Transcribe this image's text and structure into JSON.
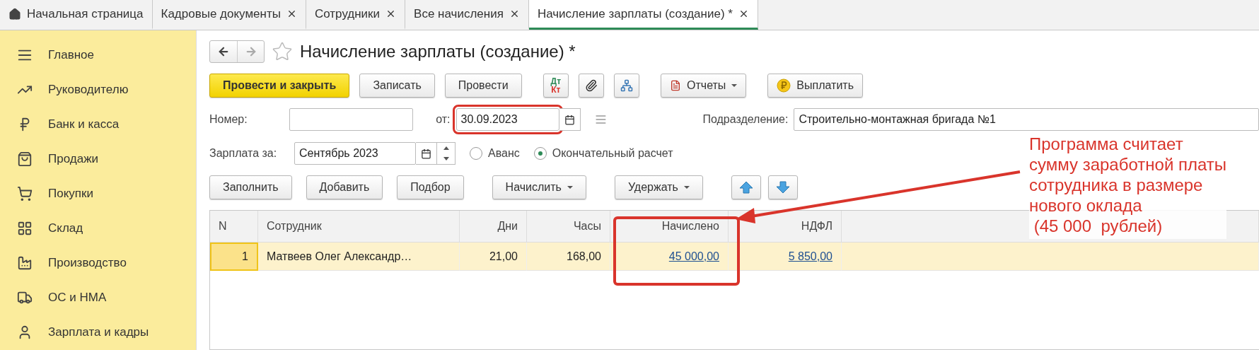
{
  "tabs": [
    {
      "kind": "home",
      "label": "Начальная страница",
      "selected": false
    },
    {
      "kind": "doc",
      "label": "Кадровые документы",
      "selected": false
    },
    {
      "kind": "doc",
      "label": "Сотрудники",
      "selected": false
    },
    {
      "kind": "doc",
      "label": "Все начисления",
      "selected": false
    },
    {
      "kind": "doc",
      "label": "Начисление зарплаты (создание) *",
      "selected": true
    }
  ],
  "sidebar": {
    "items": [
      {
        "kind": "menu",
        "label": "Главное"
      },
      {
        "kind": "trend",
        "label": "Руководителю"
      },
      {
        "kind": "ruble",
        "label": "Банк и касса"
      },
      {
        "kind": "bag",
        "label": "Продажи"
      },
      {
        "kind": "cart",
        "label": "Покупки"
      },
      {
        "kind": "grid",
        "label": "Склад"
      },
      {
        "kind": "factory",
        "label": "Производство"
      },
      {
        "kind": "truck",
        "label": "ОС и НМА"
      },
      {
        "kind": "person",
        "label": "Зарплата и кадры"
      }
    ]
  },
  "form": {
    "title": "Начисление зарплаты (создание) *",
    "toolbar": [
      {
        "kind": "primary",
        "label": "Провести и закрыть"
      },
      {
        "kind": "plain",
        "label": "Записать"
      },
      {
        "kind": "plain",
        "label": "Провести"
      },
      {
        "kind": "dtkt",
        "top": "Дт",
        "bottom": "Кт"
      },
      {
        "kind": "clip"
      },
      {
        "kind": "structure"
      },
      {
        "kind": "reports",
        "label": "Отчеты"
      },
      {
        "kind": "pay",
        "label": "Выплатить"
      }
    ],
    "number": {
      "label": "Номер:"
    },
    "date": {
      "label": "от:",
      "value": "30.09.2023",
      "highlighted": true
    },
    "department": {
      "label": "Подразделение:",
      "value": "Строительно-монтажная бригада №1"
    },
    "period": {
      "label": "Зарплата за:",
      "value": "Сентябрь 2023"
    },
    "payment_type": [
      {
        "label": "Аванс",
        "selected": false
      },
      {
        "label": "Окончательный расчет",
        "selected": true
      }
    ],
    "table_toolbar": [
      {
        "kind": "plain",
        "label": "Заполнить"
      },
      {
        "kind": "plain",
        "label": "Добавить"
      },
      {
        "kind": "plain",
        "label": "Подбор"
      },
      {
        "kind": "menu",
        "label": "Начислить"
      },
      {
        "kind": "menu",
        "label": "Удержать"
      },
      {
        "kind": "up"
      },
      {
        "kind": "down"
      }
    ]
  },
  "table": {
    "columns": [
      {
        "label": "N",
        "kind": "index",
        "highlighted": false
      },
      {
        "label": "Сотрудник",
        "kind": "text",
        "highlighted": false
      },
      {
        "label": "Дни",
        "kind": "number",
        "highlighted": false
      },
      {
        "label": "Часы",
        "kind": "number",
        "highlighted": false
      },
      {
        "label": "Начислено",
        "kind": "link",
        "highlighted": true
      },
      {
        "label": "НДФЛ",
        "kind": "link",
        "highlighted": false
      }
    ],
    "rows": [
      {
        "selected": true,
        "cells": [
          "1",
          "Матвеев Олег Александр…",
          "21,00",
          "168,00",
          "45 000,00",
          "5 850,00"
        ]
      }
    ]
  },
  "annotation": {
    "text": "Программа считает\nсумму заработной платы\nсотрудника в размере\nнового оклада\n (45 000  рублей)"
  }
}
